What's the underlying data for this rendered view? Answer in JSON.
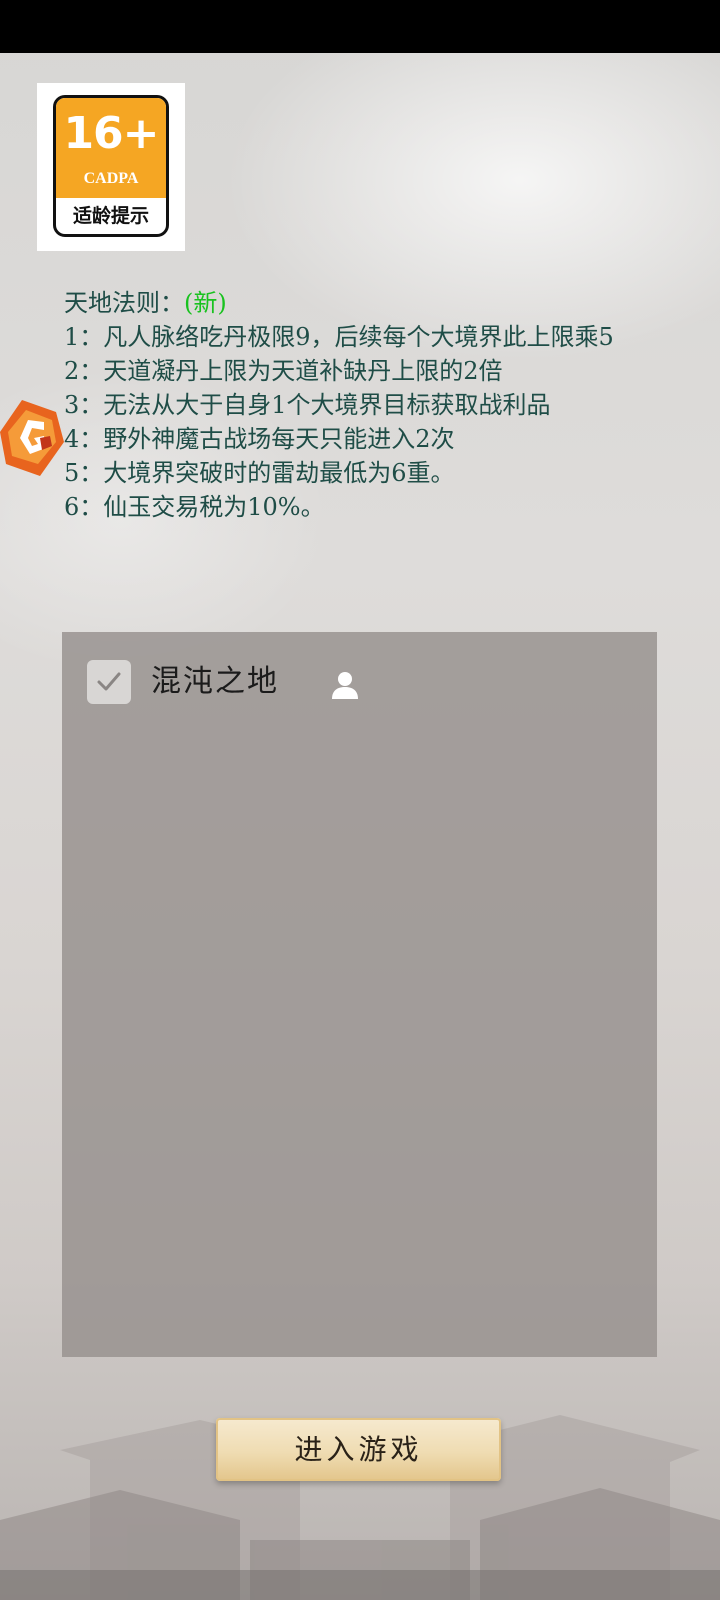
{
  "age_rating": {
    "number": "16+",
    "org": "CADPA",
    "caption": "适龄提示"
  },
  "rules": {
    "title": "天地法则：",
    "new_tag": "(新)",
    "items": [
      "1：凡人脉络吃丹极限9，后续每个大境界此上限乘5",
      "2：天道凝丹上限为天道补缺丹上限的2倍",
      "3：无法从大于自身1个大境界目标获取战利品",
      "4：野外神魔古战场每天只能进入2次",
      "5：大境界突破时的雷劫最低为6重。",
      "6：仙玉交易税为10%。"
    ]
  },
  "server_list": {
    "servers": [
      {
        "name": "混沌之地",
        "checked": true
      }
    ]
  },
  "enter_button": {
    "label": "进入游戏"
  },
  "colors": {
    "rules_text": "#1f4d47",
    "new_tag": "#19c21f",
    "badge_orange": "#f5a623"
  }
}
